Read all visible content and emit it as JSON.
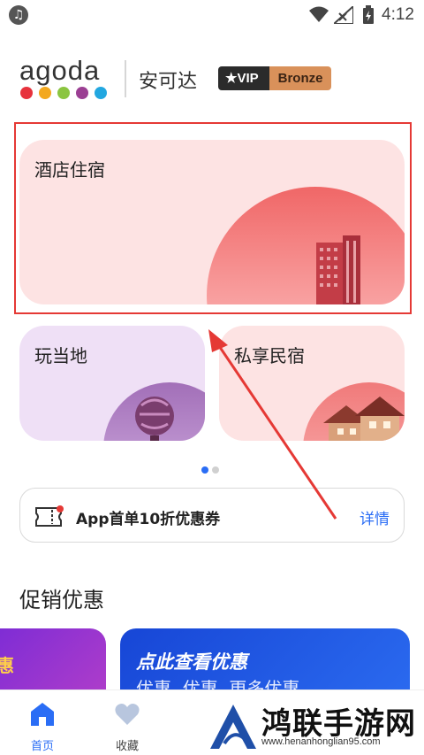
{
  "status_bar": {
    "time": "4:12",
    "icons": [
      "music-icon",
      "wifi-icon",
      "signal-icon",
      "battery-icon"
    ]
  },
  "header": {
    "logo_text": "agoda",
    "logo_dot_colors": [
      "#e7323c",
      "#f3a81e",
      "#8bc540",
      "#9b3f93",
      "#22a7e0"
    ],
    "chinese_name": "安可达",
    "vip_label": "VIP",
    "vip_tier": "Bronze"
  },
  "cards": {
    "hotel": "酒店住宿",
    "play": "玩当地",
    "private_stay": "私享民宿"
  },
  "pager": {
    "count": 2,
    "active": 0
  },
  "coupon": {
    "text": "App首单10折优惠券",
    "details": "详情"
  },
  "promotions": {
    "title": "促销优惠",
    "card1_tag": "惠",
    "card2_title": "点此查看优惠",
    "card2_sub": "优惠, 优惠, 更多优惠"
  },
  "bottom_nav": {
    "home": "首页",
    "favorites": "收藏"
  },
  "watermark": {
    "text": "鸿联手游网",
    "url": "www.henanhonglian95.com"
  },
  "colors": {
    "accent": "#2a6df5",
    "highlight_box": "#e53935"
  }
}
